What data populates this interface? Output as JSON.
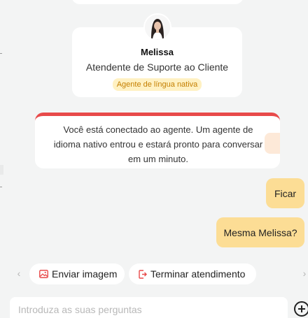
{
  "agent": {
    "name": "Melissa",
    "role": "Atendente de Suporte ao Cliente",
    "badge": "Agente de língua nativa"
  },
  "system_message": "Você está conectado ao agente. Um agente de idioma nativo entrou e estará pronto para conversar em um minuto.",
  "messages": [
    {
      "text": "Ficar"
    },
    {
      "text": "Mesma Melissa?"
    }
  ],
  "quick_actions": {
    "send_image": "Enviar imagem",
    "end_chat": "Terminar atendimento"
  },
  "input": {
    "placeholder": "Introduza as suas perguntas"
  },
  "colors": {
    "user_bubble": "#fcdd95",
    "alert_bar": "#e84a4a",
    "badge_text": "#c47f00",
    "badge_bg": "#fff1c2",
    "action_icon": "#e84a4a"
  }
}
